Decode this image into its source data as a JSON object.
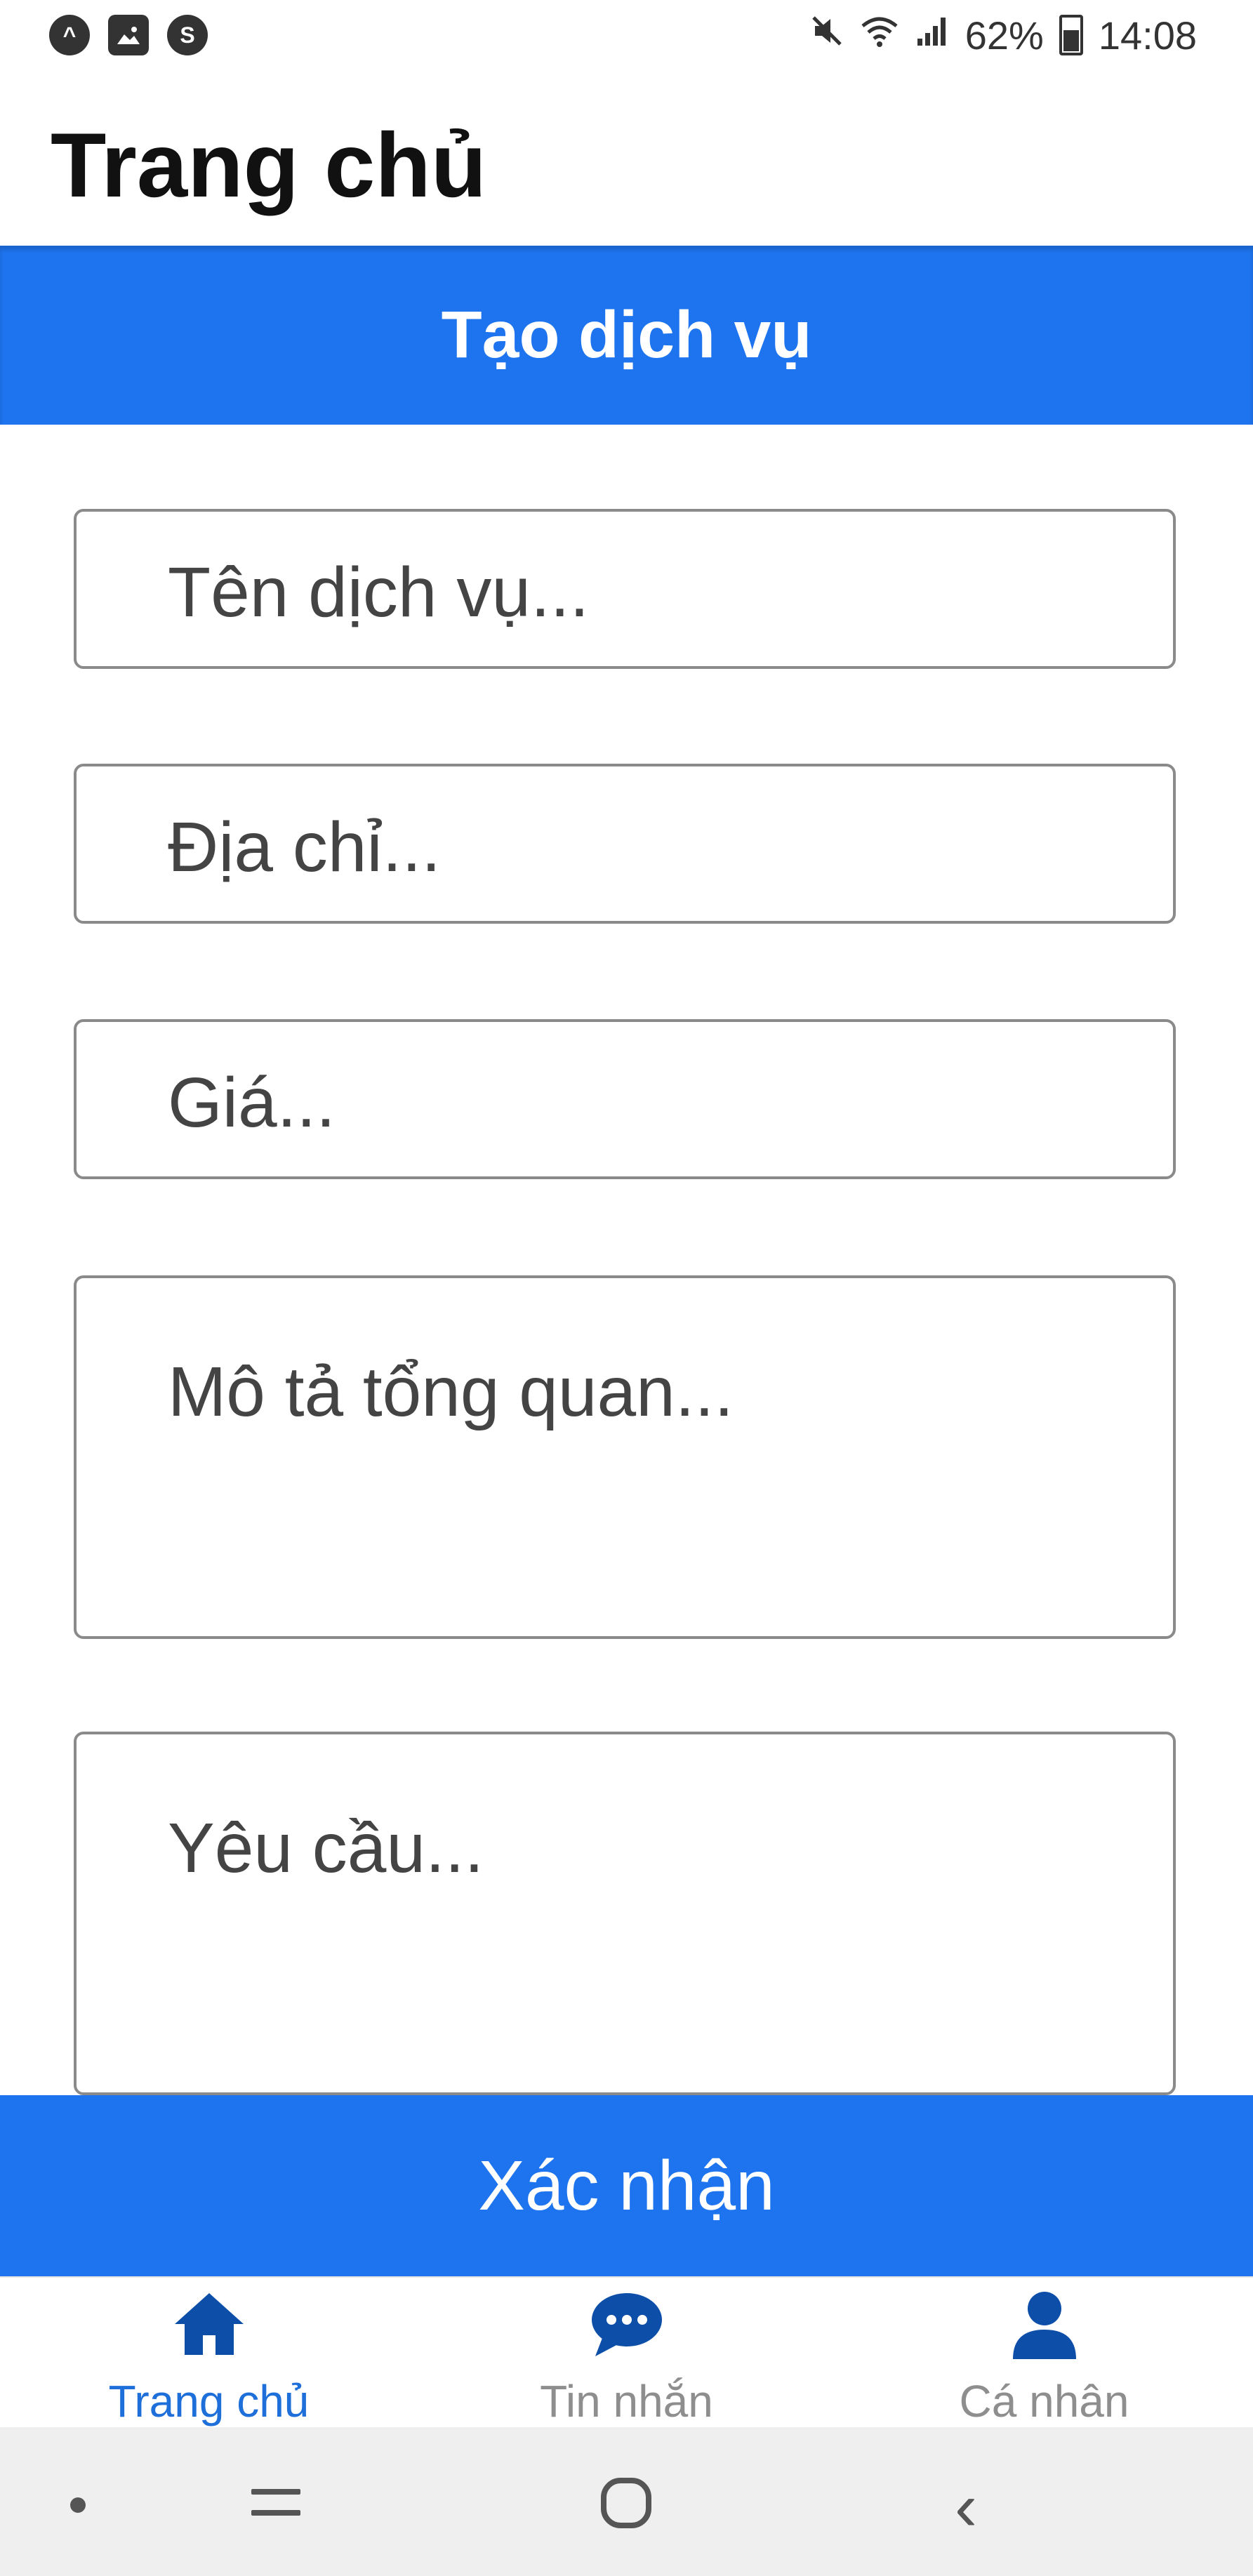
{
  "status_bar": {
    "battery": "62%",
    "time": "14:08",
    "left_icons": [
      "assistant-icon",
      "image-icon",
      "sync-icon"
    ],
    "right_icons": [
      "mute-icon",
      "wifi-icon",
      "signal-icon",
      "battery-icon"
    ]
  },
  "header": {
    "title": "Trang chủ"
  },
  "section": {
    "title": "Tạo dịch vụ"
  },
  "form": {
    "name_placeholder": "Tên dịch vụ...",
    "address_placeholder": "Địa chỉ...",
    "price_placeholder": "Giá...",
    "overview_placeholder": "Mô tả tổng quan...",
    "requirements_placeholder": "Yêu cầu...",
    "confirm_label": "Xác nhận"
  },
  "tab_bar": {
    "items": [
      {
        "label": "Trang chủ",
        "icon": "home-icon",
        "active": true
      },
      {
        "label": "Tin nhắn",
        "icon": "chat-icon",
        "active": false
      },
      {
        "label": "Cá nhân",
        "icon": "person-icon",
        "active": false
      }
    ]
  },
  "colors": {
    "primary": "#1e74ee",
    "active_tab": "#1e6fd9",
    "inactive_tab": "#8e8e8e",
    "icon_blue": "#0d4fa8"
  }
}
